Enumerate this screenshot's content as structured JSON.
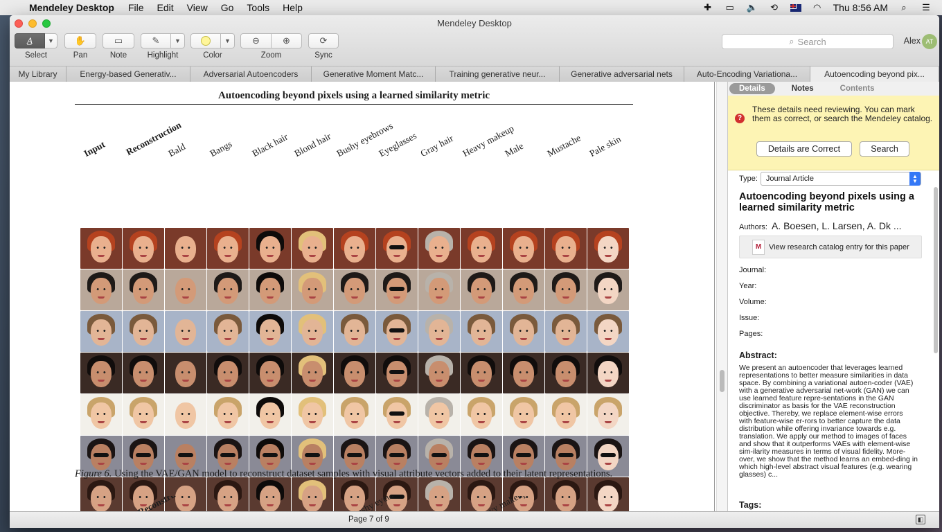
{
  "menubar": {
    "app_name": "Mendeley Desktop",
    "menus": [
      "File",
      "Edit",
      "View",
      "Go",
      "Tools",
      "Help"
    ],
    "clock": "Thu 8:56 AM"
  },
  "window": {
    "title": "Mendeley Desktop",
    "toolbar": {
      "select": "Select",
      "pan": "Pan",
      "note": "Note",
      "highlight": "Highlight",
      "color": "Color",
      "zoom": "Zoom",
      "sync": "Sync"
    },
    "search_placeholder": "Search",
    "user_name": "Alex",
    "user_initials": "AT"
  },
  "tabs": [
    "My Library",
    "Energy-based Generativ...",
    "Adversarial Autoencoders",
    "Generative Moment Matc...",
    "Training generative neur...",
    "Generative adversarial nets",
    "Auto-Encoding Variationa...",
    "Autoencoding beyond pix..."
  ],
  "document": {
    "title": "Autoencoding beyond pixels using a learned similarity metric",
    "columns": [
      "Input",
      "Reconstruction",
      "Bald",
      "Bangs",
      "Black hair",
      "Blond hair",
      "Bushy eyebrows",
      "Eyeglasses",
      "Gray hair",
      "Heavy makeup",
      "Male",
      "Mustache",
      "Pale skin"
    ],
    "caption_label": "Figure 6.",
    "caption_text": " Using the VAE/GAN model to reconstruct dataset samples with visual attribute vectors added to their latent representations.",
    "page_info": "Page 7 of 9"
  },
  "panel": {
    "tabs": [
      "Details",
      "Notes",
      "Contents"
    ],
    "review_message": "These details need reviewing. You can mark them as correct, or search the Mendeley catalog.",
    "btn_correct": "Details are Correct",
    "btn_search": "Search",
    "type_label": "Type:",
    "type_value": "Journal Article",
    "paper_title": "Autoencoding beyond pixels using a learned similarity metric",
    "authors_label": "Authors:",
    "authors_value": "A. Boesen, L. Larsen, A. Dk ...",
    "catalog_btn": "View research catalog entry for this paper",
    "fields": [
      "Journal:",
      "Year:",
      "Volume:",
      "Issue:",
      "Pages:"
    ],
    "abstract_label": "Abstract:",
    "abstract_text": "We present an autoencoder that leverages learned representations to better measure similarities in data space. By combining a variational autoen-coder (VAE) with a generative adversarial net-work (GAN) we can use learned feature repre-sentations in the GAN discriminator as basis for the VAE reconstruction objective. Thereby, we replace element-wise errors with feature-wise er-rors to better capture the data distribution while offering invariance towards e.g. translation. We apply our method to images of faces and show that it outperforms VAEs with element-wise sim-ilarity measures in terms of visual fidelity. More-over, we show that the method learns an embed-ding in which high-level abstract visual features (e.g. wearing glasses) c...",
    "tags_label": "Tags:"
  }
}
